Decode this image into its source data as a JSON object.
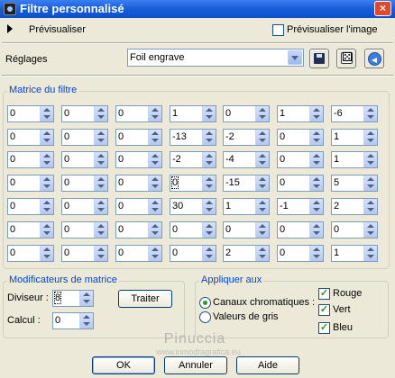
{
  "window": {
    "title": "Filtre personnalisé"
  },
  "preview": {
    "label": "Prévisualiser",
    "preview_image_label": "Prévisualiser l'image",
    "preview_image_checked": false
  },
  "settings": {
    "label": "Réglages",
    "preset_value": "Foil engrave"
  },
  "matrix": {
    "title": "Matrice du filtre",
    "rows": [
      [
        "0",
        "0",
        "0",
        "1",
        "0",
        "1",
        "-6"
      ],
      [
        "0",
        "0",
        "0",
        "-13",
        "-2",
        "0",
        "1"
      ],
      [
        "0",
        "0",
        "0",
        "-2",
        "-4",
        "0",
        "1"
      ],
      [
        "0",
        "0",
        "0",
        "0",
        "-15",
        "0",
        "5"
      ],
      [
        "0",
        "0",
        "0",
        "30",
        "1",
        "-1",
        "2"
      ],
      [
        "0",
        "0",
        "0",
        "0",
        "0",
        "0",
        "0"
      ],
      [
        "0",
        "0",
        "0",
        "0",
        "2",
        "0",
        "1"
      ]
    ]
  },
  "modifiers": {
    "title": "Modificateurs de matrice",
    "divisor_label": "Diviseur :",
    "divisor_value": "8",
    "bias_label": "Calcul :",
    "bias_value": "0",
    "compute_button": "Traiter"
  },
  "apply": {
    "title": "Appliquer aux",
    "channels_label": "Canaux chromatiques :",
    "grey_label": "Valeurs de gris",
    "red_label": "Rouge",
    "green_label": "Vert",
    "blue_label": "Bleu"
  },
  "watermark": {
    "text": "Pinuccia",
    "sub": "www.inmodragrafica.eu"
  },
  "footer": {
    "ok_label": "OK",
    "cancel_label": "Annuler",
    "help_label": "Aide"
  }
}
